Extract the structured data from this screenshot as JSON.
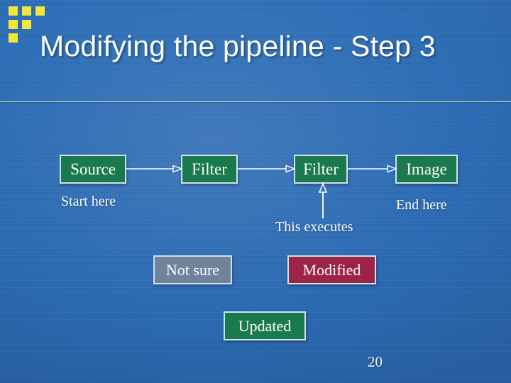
{
  "slide": {
    "title": "Modifying the pipeline - Step 3",
    "page_number": "20",
    "background_color": "#2b6bb4",
    "accent_color": "#f5e63c",
    "rule_color": "#e9e6d2"
  },
  "decoration": {
    "name": "yellow-square-cluster",
    "color": "#f5e63c",
    "squares": 6
  },
  "diagram": {
    "pipeline": {
      "nodes": [
        {
          "id": "source",
          "label": "Source",
          "color": "#1a7a4e",
          "border": "#cfe0ef"
        },
        {
          "id": "filter1",
          "label": "Filter",
          "color": "#1a7a4e",
          "border": "#cfe0ef"
        },
        {
          "id": "filter2",
          "label": "Filter",
          "color": "#1a7a4e",
          "border": "#cfe0ef"
        },
        {
          "id": "image",
          "label": "Image",
          "color": "#1a7a4e",
          "border": "#cfe0ef"
        }
      ],
      "connectors": [
        {
          "from": "source",
          "to": "filter1",
          "style": "arrow-right"
        },
        {
          "from": "filter1",
          "to": "filter2",
          "style": "arrow-right"
        },
        {
          "from": "filter2",
          "to": "image",
          "style": "arrow-right"
        }
      ]
    },
    "captions": {
      "start": "Start here",
      "end": "End here",
      "executes": "This executes"
    },
    "legend": [
      {
        "id": "not-sure",
        "label": "Not sure",
        "color": "#6f8399",
        "border": "#cfe0ef"
      },
      {
        "id": "modified",
        "label": "Modified",
        "color": "#9c2444",
        "border": "#cfe0ef"
      },
      {
        "id": "updated",
        "label": "Updated",
        "color": "#1a7a4e",
        "border": "#cfe0ef"
      }
    ]
  }
}
